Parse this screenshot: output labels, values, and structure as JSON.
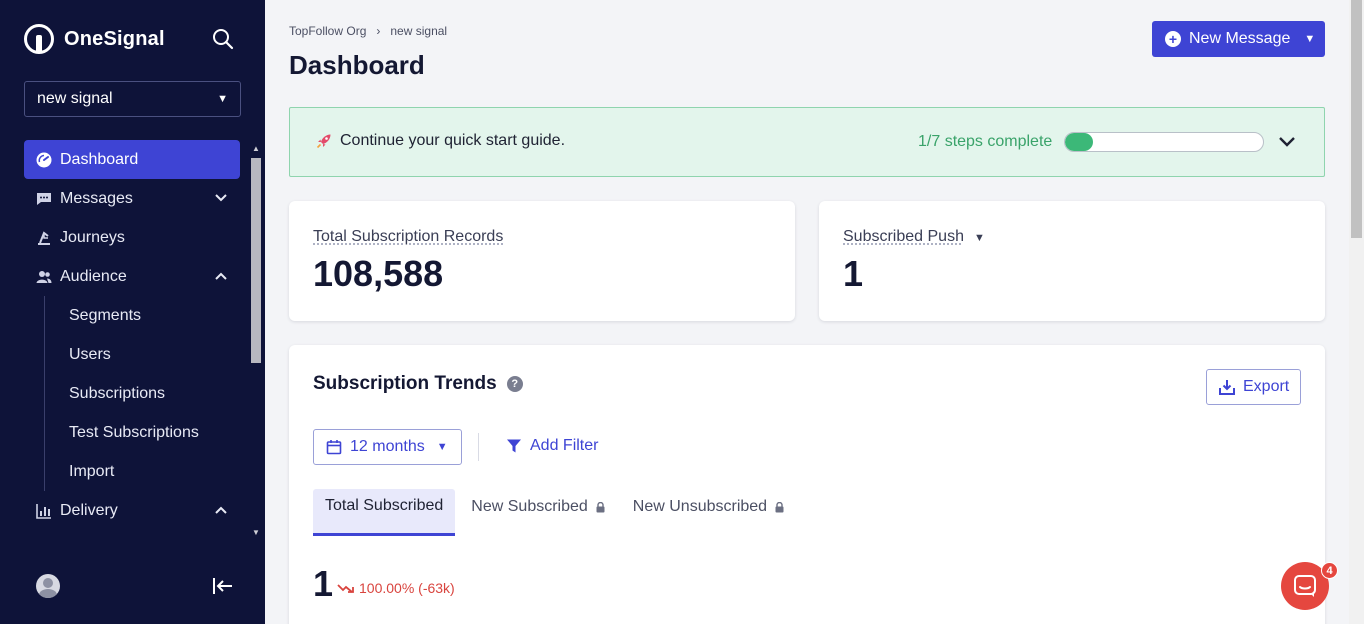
{
  "sidebar": {
    "brand": "OneSignal",
    "app_selector": "new signal",
    "items": [
      {
        "label": "Dashboard",
        "icon": "dashboard-icon",
        "active": true
      },
      {
        "label": "Messages",
        "icon": "messages-icon",
        "expanded": false
      },
      {
        "label": "Journeys",
        "icon": "journeys-icon"
      },
      {
        "label": "Audience",
        "icon": "audience-icon",
        "expanded": true,
        "children": [
          "Segments",
          "Users",
          "Subscriptions",
          "Test Subscriptions",
          "Import"
        ]
      },
      {
        "label": "Delivery",
        "icon": "delivery-icon",
        "expanded": true
      }
    ]
  },
  "header": {
    "breadcrumb": [
      "TopFollow Org",
      "new signal"
    ],
    "breadcrumb_separator": "›",
    "title": "Dashboard",
    "new_message_label": "New Message"
  },
  "quick_start": {
    "text": "Continue your quick start guide.",
    "steps_text": "1/7 steps complete",
    "progress": 0.1428
  },
  "stats": [
    {
      "label": "Total Subscription Records",
      "value": "108,588"
    },
    {
      "label": "Subscribed Push",
      "value": "1"
    }
  ],
  "trends": {
    "title": "Subscription Trends",
    "help": "?",
    "export_label": "Export",
    "range_label": "12 months",
    "add_filter_label": "Add Filter",
    "tabs": [
      "Total Subscribed",
      "New Subscribed",
      "New Unsubscribed"
    ],
    "value": "1",
    "delta": "100.00% (-63k)"
  },
  "chat": {
    "badge": "4"
  },
  "colors": {
    "sidebar_bg": "#0e1339",
    "accent": "#3e44d4",
    "success": "#3cb878",
    "danger": "#d9443e"
  }
}
